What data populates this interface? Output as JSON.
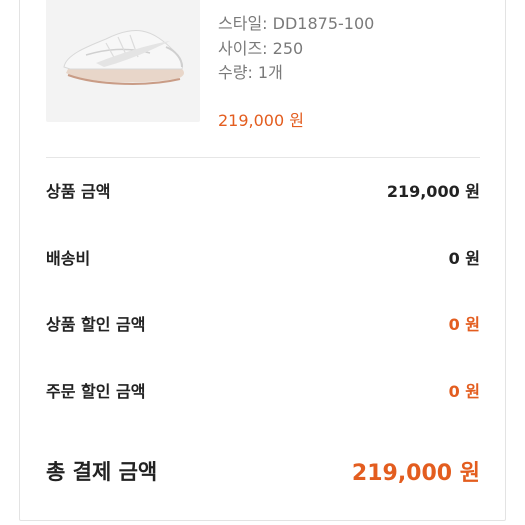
{
  "product": {
    "image_icon": "sneaker-image",
    "style": "스타일: DD1875-100",
    "size": "사이즈: 250",
    "quantity": "수량: 1개",
    "price": "219,000 원"
  },
  "summary": {
    "rows": [
      {
        "label": "상품 금액",
        "value": "219,000 원",
        "type": "normal"
      },
      {
        "label": "배송비",
        "value": "0 원",
        "type": "normal"
      },
      {
        "label": "상품 할인 금액",
        "value": "0 원",
        "type": "discount"
      },
      {
        "label": "주문 할인 금액",
        "value": "0 원",
        "type": "discount"
      }
    ],
    "total_label": "총 결제 금액",
    "total_value": "219,000 원"
  },
  "colors": {
    "accent": "#e35d1f",
    "text": "#222222",
    "muted": "#7a7a7a",
    "divider": "#e6e6e6"
  }
}
